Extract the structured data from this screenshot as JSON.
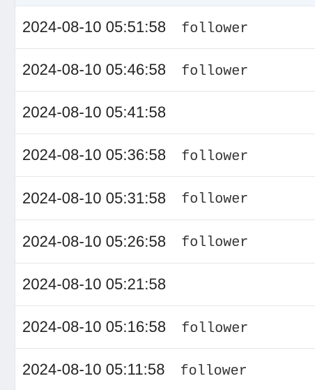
{
  "log": {
    "rows": [
      {
        "timestamp": "2024-08-10 05:51:58",
        "role": "follower"
      },
      {
        "timestamp": "2024-08-10 05:46:58",
        "role": "follower"
      },
      {
        "timestamp": "2024-08-10 05:41:58",
        "role": ""
      },
      {
        "timestamp": "2024-08-10 05:36:58",
        "role": "follower"
      },
      {
        "timestamp": "2024-08-10 05:31:58",
        "role": "follower"
      },
      {
        "timestamp": "2024-08-10 05:26:58",
        "role": "follower"
      },
      {
        "timestamp": "2024-08-10 05:21:58",
        "role": ""
      },
      {
        "timestamp": "2024-08-10 05:16:58",
        "role": "follower"
      },
      {
        "timestamp": "2024-08-10 05:11:58",
        "role": "follower"
      }
    ]
  }
}
